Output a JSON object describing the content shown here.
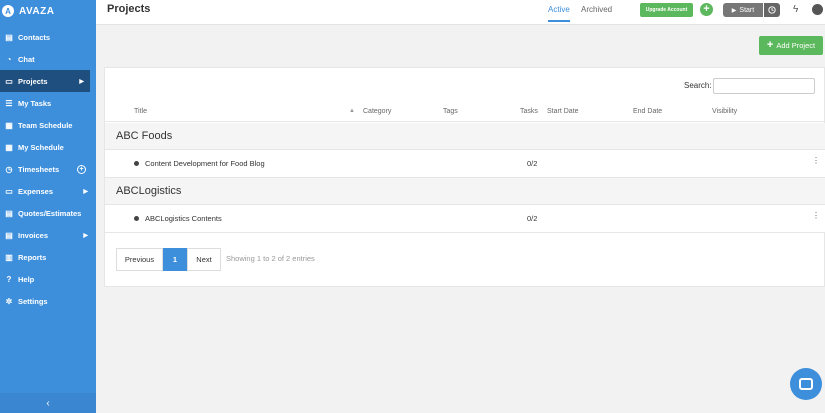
{
  "brand": {
    "name": "AVAZA",
    "logo_letter": "A"
  },
  "sidebar": {
    "items": [
      {
        "label": "Contacts",
        "icon": "contacts-icon",
        "glyph": "▤"
      },
      {
        "label": "Chat",
        "icon": "chat-icon",
        "glyph": "◔"
      },
      {
        "label": "Projects",
        "icon": "folder-icon",
        "glyph": "▭",
        "active": true
      },
      {
        "label": "My Tasks",
        "icon": "tasks-icon",
        "glyph": "☰"
      },
      {
        "label": "Team Schedule",
        "icon": "team-schedule-icon",
        "glyph": "▦"
      },
      {
        "label": "My Schedule",
        "icon": "calendar-icon",
        "glyph": "▦"
      },
      {
        "label": "Timesheets",
        "icon": "stopwatch-icon",
        "glyph": "◷"
      },
      {
        "label": "Expenses",
        "icon": "laptop-icon",
        "glyph": "▭"
      },
      {
        "label": "Quotes/Estimates",
        "icon": "document-icon",
        "glyph": "▤"
      },
      {
        "label": "Invoices",
        "icon": "invoice-icon",
        "glyph": "▤"
      },
      {
        "label": "Reports",
        "icon": "reports-icon",
        "glyph": "▥"
      },
      {
        "label": "Help",
        "icon": "help-icon",
        "glyph": "?"
      },
      {
        "label": "Settings",
        "icon": "gear-icon",
        "glyph": "✲"
      }
    ],
    "arrow_glyph": "▶",
    "plus_glyph": "+",
    "collapse_glyph": "‹"
  },
  "header": {
    "title": "Projects",
    "tabs": [
      {
        "label": "Active",
        "active": true
      },
      {
        "label": "Archived",
        "active": false
      }
    ],
    "upgrade_label": "Upgrade Account",
    "plus_glyph": "+",
    "start_label": "Start",
    "start_glyph": "▶",
    "bolt_glyph": "ϟ"
  },
  "actions": {
    "add_project_label": "Add Project",
    "add_project_glyph": "+"
  },
  "table": {
    "search_label": "Search:",
    "search_value": "",
    "columns": [
      "Title",
      "Category",
      "Tags",
      "Tasks",
      "Start Date",
      "End Date",
      "Visibility"
    ],
    "sort_glyph": "▲",
    "kebab_glyph": "⋮",
    "groups": [
      {
        "name": "ABC Foods",
        "rows": [
          {
            "title": "Content Development for Food Blog",
            "tasks": "0/2"
          }
        ]
      },
      {
        "name": "ABCLogistics",
        "rows": [
          {
            "title": "ABCLogistics Contents",
            "tasks": "0/2"
          }
        ]
      }
    ]
  },
  "pagination": {
    "previous_label": "Previous",
    "current_page": "1",
    "next_label": "Next",
    "entries_text": "Showing 1 to 2 of 2 entries"
  },
  "colors": {
    "primary": "#3d8fdc",
    "sidebar_active": "#1e4f7f",
    "success": "#5cb85c"
  }
}
